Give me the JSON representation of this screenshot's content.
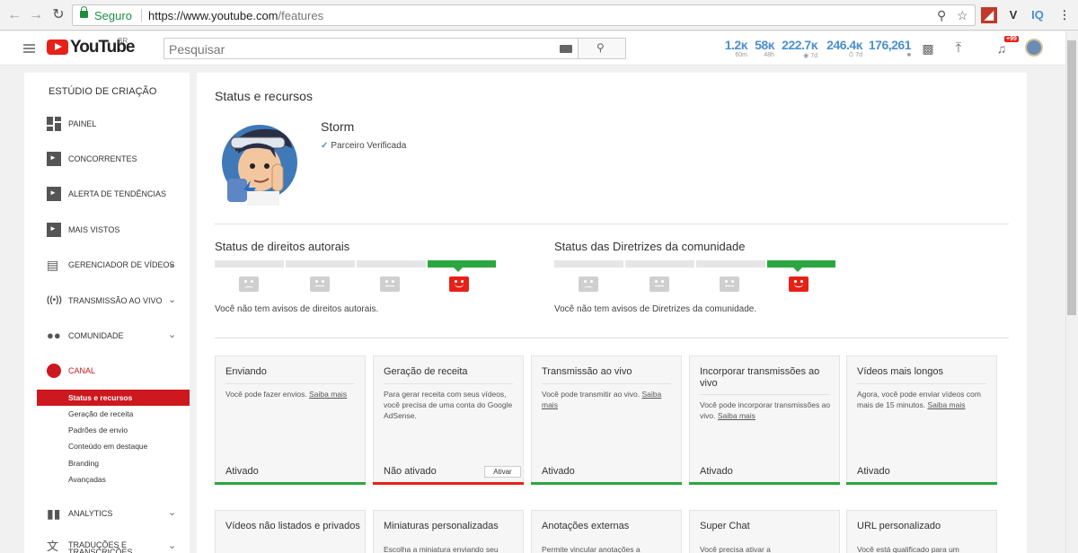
{
  "browser": {
    "secure_label": "Seguro",
    "url_host": "https://www.youtube.com",
    "url_path": "/features",
    "ext_v": "V",
    "ext_iq": "IQ"
  },
  "header": {
    "logo_text": "YouTube",
    "region": "BR",
    "search_placeholder": "Pesquisar",
    "stats": [
      {
        "value": "1.2ĸ",
        "sub": "60m"
      },
      {
        "value": "58ĸ",
        "sub": "48h"
      },
      {
        "value": "222.7ĸ",
        "sub": "7d"
      },
      {
        "value": "246.4ĸ",
        "sub": "7d"
      },
      {
        "value": "176,261",
        "sub": ""
      }
    ],
    "notification_count": "+99"
  },
  "sidebar": {
    "title": "ESTÚDIO DE CRIAÇÃO",
    "items": [
      {
        "label": "PAINEL"
      },
      {
        "label": "CONCORRENTES"
      },
      {
        "label": "ALERTA DE TENDÊNCIAS"
      },
      {
        "label": "MAIS VISTOS"
      },
      {
        "label": "GERENCIADOR DE VÍDEOS"
      },
      {
        "label": "TRANSMISSÃO AO VIVO"
      },
      {
        "label": "COMUNIDADE"
      },
      {
        "label": "CANAL"
      },
      {
        "label": "ANALYTICS"
      },
      {
        "label": "TRADUÇÕES E TRANSCRIÇÕES"
      }
    ],
    "canal_sub": [
      {
        "label": "Status e recursos"
      },
      {
        "label": "Geração de receita"
      },
      {
        "label": "Padrões de envio"
      },
      {
        "label": "Conteúdo em destaque"
      },
      {
        "label": "Branding"
      },
      {
        "label": "Avançadas"
      }
    ],
    "active_color": "#cc181e"
  },
  "main": {
    "title": "Status e recursos",
    "channel_name": "Storm",
    "verified_label": "Parceiro Verificada",
    "copyright": {
      "title": "Status de direitos autorais",
      "text": "Você não tem avisos de direitos autorais."
    },
    "community": {
      "title": "Status das Diretrizes da comunidade",
      "text": "Você não tem avisos de Diretrizes da comunidade."
    },
    "cards": [
      {
        "title": "Enviando",
        "desc": "Você pode fazer envios.",
        "link": "Saiba mais",
        "status": "Ativado"
      },
      {
        "title": "Geração de receita",
        "desc": "Para gerar receita com seus vídeos, você precisa de uma conta do Google AdSense.",
        "link": "",
        "status": "Não ativado",
        "button": "Ativar"
      },
      {
        "title": "Transmissão ao vivo",
        "desc": "Você pode transmitir ao vivo.",
        "link": "Saiba mais",
        "status": "Ativado"
      },
      {
        "title": "Incorporar transmissões ao vivo",
        "desc": "Você pode incorporar transmissões ao vivo.",
        "link": "Saiba mais",
        "status": "Ativado"
      },
      {
        "title": "Vídeos mais longos",
        "desc": "Agora, você pode enviar vídeos com mais de 15 minutos.",
        "link": "Saiba mais",
        "status": "Ativado"
      }
    ],
    "cards_row2": [
      {
        "title": "Vídeos não listados e privados",
        "desc": ""
      },
      {
        "title": "Miniaturas personalizadas",
        "desc": "Escolha a miniatura enviando seu"
      },
      {
        "title": "Anotações externas",
        "desc": "Permite vincular anotações a"
      },
      {
        "title": "Super Chat",
        "desc": "Você precisa ativar a"
      },
      {
        "title": "URL personalizado",
        "desc": "Você está qualificado para um"
      }
    ],
    "status_colors": {
      "good": "#2ba640",
      "bad": "#e62117"
    }
  }
}
